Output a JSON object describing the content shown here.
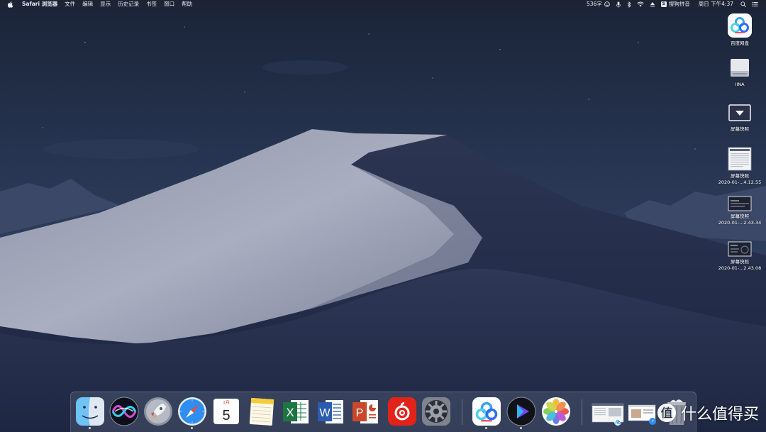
{
  "menubar": {
    "app_name": "Safari 浏览器",
    "items": [
      "文件",
      "编辑",
      "显示",
      "历史记录",
      "书签",
      "窗口",
      "帮助"
    ],
    "word_count": "536字",
    "ime_label": "搜狗拼音",
    "clock": "周日 下午4:37"
  },
  "desktop_icons": [
    {
      "name": "百度网盘",
      "sub": ""
    },
    {
      "name": "IINA",
      "sub": ""
    },
    {
      "name": "屏幕快照",
      "sub": ""
    },
    {
      "name": "屏幕快照",
      "sub": "2020-01-...4.12.55"
    },
    {
      "name": "屏幕快照",
      "sub": "2020-01-...2.43.34"
    },
    {
      "name": "屏幕快照",
      "sub": "2020-01-...2.43.08"
    }
  ],
  "dock": {
    "apps": [
      {
        "name": "Finder",
        "icon": "finder-icon",
        "running": true
      },
      {
        "name": "Siri",
        "icon": "siri-icon",
        "running": false
      },
      {
        "name": "Launchpad",
        "icon": "rocket-icon",
        "running": false
      },
      {
        "name": "Safari",
        "icon": "compass-icon",
        "running": true
      },
      {
        "name": "Calendar",
        "icon": "calendar-icon",
        "running": false,
        "month": "1月",
        "day": "5"
      },
      {
        "name": "Notes",
        "icon": "notes-icon",
        "running": false
      },
      {
        "name": "Excel",
        "icon": "excel-icon",
        "running": false,
        "letter": "X"
      },
      {
        "name": "Word",
        "icon": "word-icon",
        "running": false,
        "letter": "W"
      },
      {
        "name": "PowerPoint",
        "icon": "powerpoint-icon",
        "running": false,
        "letter": "P"
      },
      {
        "name": "NetEase Music",
        "icon": "netease-music-icon",
        "running": false
      },
      {
        "name": "System Preferences",
        "icon": "gear-icon",
        "running": false
      },
      {
        "name": "百度网盘",
        "icon": "baidu-netdisk-icon",
        "running": true
      },
      {
        "name": "Infuse",
        "icon": "play-icon",
        "running": true
      },
      {
        "name": "Photos",
        "icon": "photos-icon",
        "running": false
      }
    ],
    "trash": {
      "name": "Trash",
      "icon": "trash-icon"
    }
  },
  "watermark": {
    "text": "什么值得买",
    "icon": "smzdm-logo-icon"
  },
  "colors": {
    "sky_top": "#1b2740",
    "sky_bottom": "#3a4a6a",
    "dune_light": "#9ca2b4",
    "dune_dark": "#2a3350"
  }
}
